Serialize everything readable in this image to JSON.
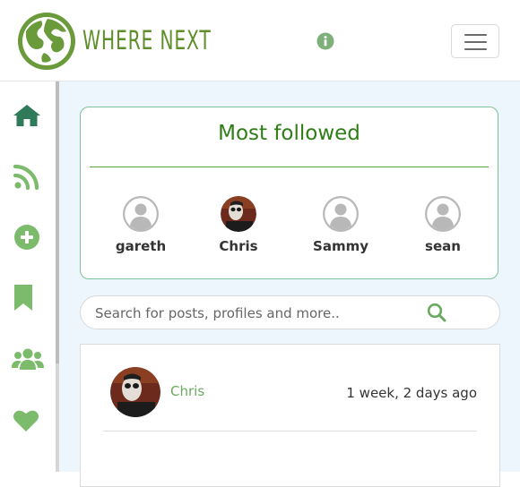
{
  "header": {
    "brand": "WHERE NEXT",
    "logo_icon": "globe-icon",
    "info_icon": "info-icon",
    "menu_icon": "hamburger-icon",
    "brand_color": "#5f8f2b"
  },
  "sidebar": {
    "items": [
      {
        "name": "home",
        "icon": "home-icon",
        "color": "#2e7a59"
      },
      {
        "name": "feed",
        "icon": "rss-icon",
        "color": "#7dbb6c"
      },
      {
        "name": "add-post",
        "icon": "plus-circle-icon",
        "color": "#7dbb6c"
      },
      {
        "name": "bookmarks",
        "icon": "bookmark-icon",
        "color": "#7dbb6c"
      },
      {
        "name": "following",
        "icon": "users-icon",
        "color": "#7dbb6c"
      },
      {
        "name": "liked",
        "icon": "heart-icon",
        "color": "#7dbb6c"
      }
    ]
  },
  "most_followed": {
    "title": "Most followed",
    "profiles": [
      {
        "name": "gareth",
        "avatar": "default-avatar"
      },
      {
        "name": "Chris",
        "avatar": "photo-avatar"
      },
      {
        "name": "Sammy",
        "avatar": "default-avatar"
      },
      {
        "name": "sean",
        "avatar": "default-avatar"
      }
    ]
  },
  "search": {
    "placeholder": "Search for posts, profiles and more..",
    "value": ""
  },
  "post": {
    "author": "Chris",
    "time": "1 week, 2 days ago"
  }
}
